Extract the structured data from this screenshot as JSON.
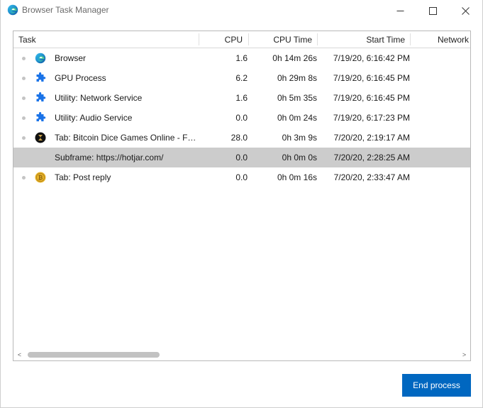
{
  "window": {
    "title": "Browser Task Manager",
    "controls": {
      "minimize": "minimize",
      "maximize": "maximize",
      "close": "close"
    }
  },
  "table": {
    "columns": [
      "Task",
      "CPU",
      "CPU Time",
      "Start Time",
      "Network"
    ],
    "rows": [
      {
        "icon": "edge-logo-icon",
        "task": "Browser",
        "cpu": "1.6",
        "cpu_time": "0h 14m 26s",
        "start_time": "7/19/20, 6:16:42 PM"
      },
      {
        "icon": "puzzle-piece-icon",
        "task": "GPU Process",
        "cpu": "6.2",
        "cpu_time": "0h 29m 8s",
        "start_time": "7/19/20, 6:16:45 PM"
      },
      {
        "icon": "puzzle-piece-icon",
        "task": "Utility: Network Service",
        "cpu": "1.6",
        "cpu_time": "0h 5m 35s",
        "start_time": "7/19/20, 6:16:45 PM"
      },
      {
        "icon": "puzzle-piece-icon",
        "task": "Utility: Audio Service",
        "cpu": "0.0",
        "cpu_time": "0h 0m 24s",
        "start_time": "7/19/20, 6:17:23 PM"
      },
      {
        "icon": "dice-favicon-icon",
        "task": "Tab: Bitcoin Dice Games Online - For...",
        "cpu": "28.0",
        "cpu_time": "0h 3m 9s",
        "start_time": "7/20/20, 2:19:17 AM"
      },
      {
        "icon": "",
        "task": "Subframe: https://hotjar.com/",
        "cpu": "0.0",
        "cpu_time": "0h 0m 0s",
        "start_time": "7/20/20, 2:28:25 AM",
        "selected": true
      },
      {
        "icon": "bitcoin-coin-icon",
        "task": "Tab: Post reply",
        "cpu": "0.0",
        "cpu_time": "0h 0m 16s",
        "start_time": "7/20/20, 2:33:47 AM"
      }
    ]
  },
  "scrollbar": {
    "left_arrow": "<",
    "right_arrow": ">"
  },
  "actions": {
    "end_process": "End process"
  },
  "colors": {
    "accent": "#0067c0",
    "selected_row": "#cccccc",
    "puzzle_icon": "#1a73e8",
    "coin_icon": "#e8b428"
  }
}
